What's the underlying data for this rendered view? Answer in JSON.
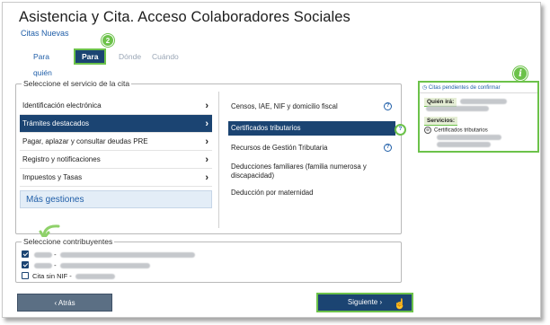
{
  "page": {
    "title": "Asistencia y Cita. Acceso Colaboradores Sociales",
    "subnav": "Citas Nuevas"
  },
  "tabs": {
    "para_quien": "Para quién",
    "para_que": "Para qué",
    "donde": "Dónde",
    "cuando": "Cuándo",
    "step_badge": "2"
  },
  "service": {
    "legend": "Seleccione el servicio de la cita",
    "left_items": [
      "Identificación electrónica",
      "Trámites destacados",
      "Pagar, aplazar y consultar deudas PRE",
      "Registro y notificaciones",
      "Impuestos y Tasas"
    ],
    "more": "Más gestiones",
    "right_items": [
      "Censos, IAE, NIF y domicilio fiscal",
      "Certificados tributarios",
      "Recursos de Gestión Tributaria",
      "Deducciones familiares (familia numerosa y discapacidad)",
      "Deducción por maternidad"
    ]
  },
  "contribuyentes": {
    "legend": "Seleccione contribuyentes",
    "cita_sin_nif": "Cita sin NIF -"
  },
  "buttons": {
    "back": "Atrás",
    "next": "Siguiente"
  },
  "sidebar": {
    "header": "Citas pendientes de confirmar",
    "quien_ira": "Quién irá:",
    "servicios": "Servicios:",
    "service_item": "Certificados tributarios",
    "info_badge": "i"
  },
  "colors": {
    "primary": "#1b4472",
    "accent_green": "#6cc24a",
    "link": "#1f5ea8"
  }
}
